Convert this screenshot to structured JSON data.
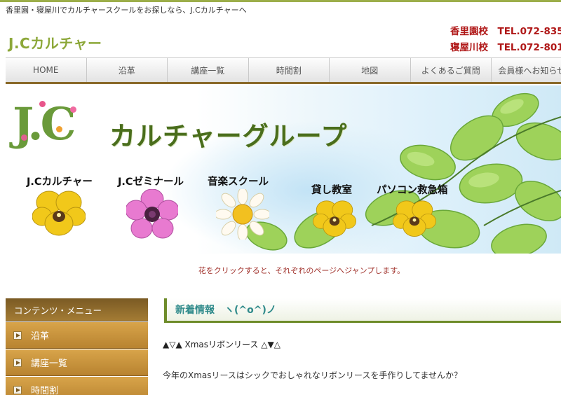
{
  "header": {
    "tagline": "香里園・寝屋川でカルチャースクールをお探しなら、J.Cカルチャーへ",
    "logo": "J.Cカルチャー",
    "contacts": [
      {
        "line": "香里園校　TEL.072-835"
      },
      {
        "line": "寝屋川校　TEL.072-801"
      }
    ]
  },
  "nav": {
    "items": [
      "HOME",
      "沿革",
      "講座一覧",
      "時間割",
      "地図",
      "よくあるご質問",
      "会員様へお知らせ"
    ]
  },
  "banner": {
    "group_title": "カルチャーグループ",
    "schools": [
      {
        "label": "J.Cカルチャー"
      },
      {
        "label": "J.Cゼミナール"
      },
      {
        "label": "音楽スクール"
      },
      {
        "label": "貸し教室"
      },
      {
        "label": "パソコン救急箱"
      }
    ],
    "caption": "花をクリックすると、それぞれのページへジャンプします。"
  },
  "sidebar": {
    "heading": "コンテンツ・メニュー",
    "items": [
      "沿革",
      "講座一覧",
      "時間割"
    ]
  },
  "news": {
    "heading": "新着情報　ヽ(^o^)ノ",
    "post_title": "▲▽▲ Xmasリボンリース △▼△",
    "post_body": "今年のXmasリースはシックでおしゃれなリボンリースを手作りしてませんか？"
  },
  "colors": {
    "accent_green": "#8da83a",
    "nav_underline": "#8a6a2a",
    "contact_red": "#b01818",
    "sidebar_gold": "#c8923c"
  }
}
